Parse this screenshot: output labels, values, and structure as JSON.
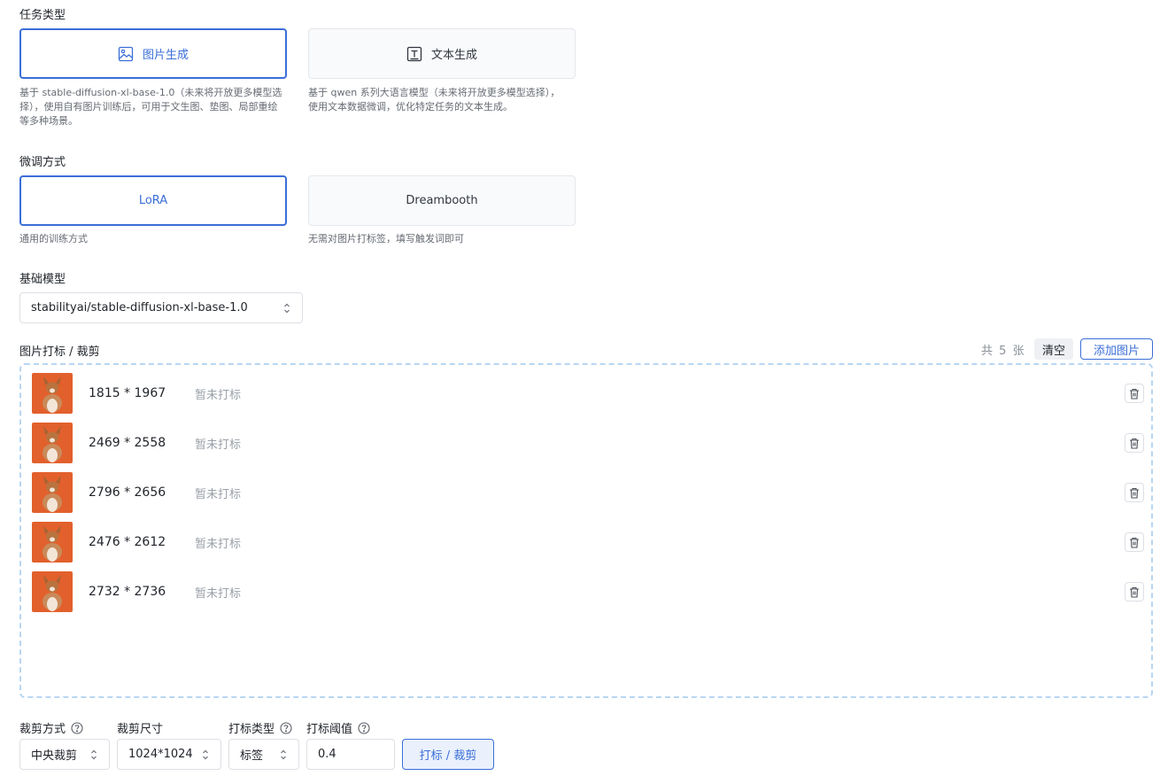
{
  "task_type": {
    "label": "任务类型",
    "options": [
      {
        "label": "图片生成",
        "icon": "image-icon",
        "selected": true,
        "desc": "基于 stable-diffusion-xl-base-1.0（未来将开放更多模型选择），使用自有图片训练后，可用于文生图、垫图、局部重绘等多种场景。"
      },
      {
        "label": "文本生成",
        "icon": "text-icon",
        "selected": false,
        "desc": "基于 qwen 系列大语言模型（未来将开放更多模型选择），使用文本数据微调，优化特定任务的文本生成。"
      }
    ]
  },
  "finetune_method": {
    "label": "微调方式",
    "options": [
      {
        "label": "LoRA",
        "selected": true,
        "desc": "通用的训练方式"
      },
      {
        "label": "Dreambooth",
        "selected": false,
        "desc": "无需对图片打标签，填写触发词即可"
      }
    ]
  },
  "base_model": {
    "label": "基础模型",
    "value": "stabilityai/stable-diffusion-xl-base-1.0"
  },
  "images": {
    "label": "图片打标 / 裁剪",
    "count_prefix": "共",
    "count": "5",
    "count_suffix": "张",
    "clear_label": "清空",
    "add_label": "添加图片",
    "items": [
      {
        "dims": "1815 * 1967",
        "status": "暂未打标"
      },
      {
        "dims": "2469 * 2558",
        "status": "暂未打标"
      },
      {
        "dims": "2796 * 2656",
        "status": "暂未打标"
      },
      {
        "dims": "2476 * 2612",
        "status": "暂未打标"
      },
      {
        "dims": "2732 * 2736",
        "status": "暂未打标"
      }
    ]
  },
  "controls": {
    "crop_mode_label": "裁剪方式",
    "crop_mode_value": "中央裁剪",
    "crop_size_label": "裁剪尺寸",
    "crop_size_value": "1024*1024",
    "tag_type_label": "打标类型",
    "tag_type_value": "标签",
    "threshold_label": "打标阈值",
    "threshold_value": "0.4",
    "run_label": "打标 / 裁剪"
  },
  "colors": {
    "accent": "#3b6ed7",
    "thumb_bg": "#e2602c",
    "dashed_border": "#b8d6f2"
  }
}
